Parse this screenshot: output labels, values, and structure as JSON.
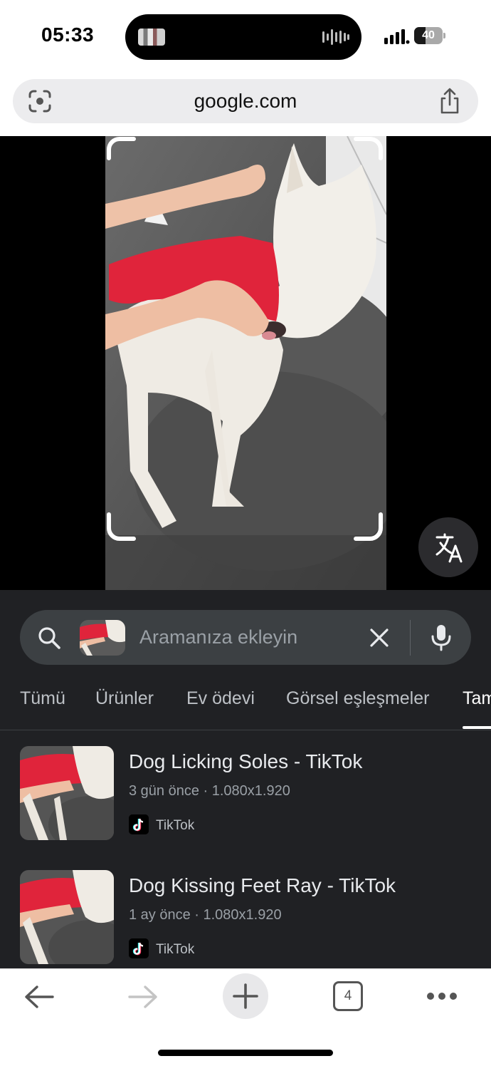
{
  "status_bar": {
    "time": "05:33",
    "battery": "40",
    "battery_level": 0.4
  },
  "browser": {
    "url": "google.com",
    "lens_icon": "google-lens-icon",
    "share_icon": "share-icon"
  },
  "viewer": {
    "translate_icon": "translate-icon",
    "colors": {
      "sweater": "#e0243b",
      "sofa": "#5a5a5a",
      "dog": "#efebe4",
      "background": "#000000"
    }
  },
  "search": {
    "placeholder": "Aramanıza ekleyin",
    "search_icon": "search-icon",
    "clear_icon": "close-icon",
    "mic_icon": "mic-icon"
  },
  "tabs": [
    {
      "label": "Tümü",
      "active": false
    },
    {
      "label": "Ürünler",
      "active": false
    },
    {
      "label": "Ev ödevi",
      "active": false
    },
    {
      "label": "Görsel eşleşmeler",
      "active": false
    },
    {
      "label": "Tam",
      "active": true
    }
  ],
  "results": [
    {
      "title": "Dog Licking Soles - TikTok",
      "meta": "3 gün önce · 1.080x1.920",
      "source": "TikTok"
    },
    {
      "title": "Dog Kissing Feet Ray - TikTok",
      "meta": "1 ay önce · 1.080x1.920",
      "source": "TikTok"
    }
  ],
  "toolbar": {
    "back_icon": "back-arrow-icon",
    "forward_icon": "forward-arrow-icon",
    "new_tab_icon": "plus-icon",
    "tab_count": "4",
    "menu_icon": "more-dots-icon"
  }
}
